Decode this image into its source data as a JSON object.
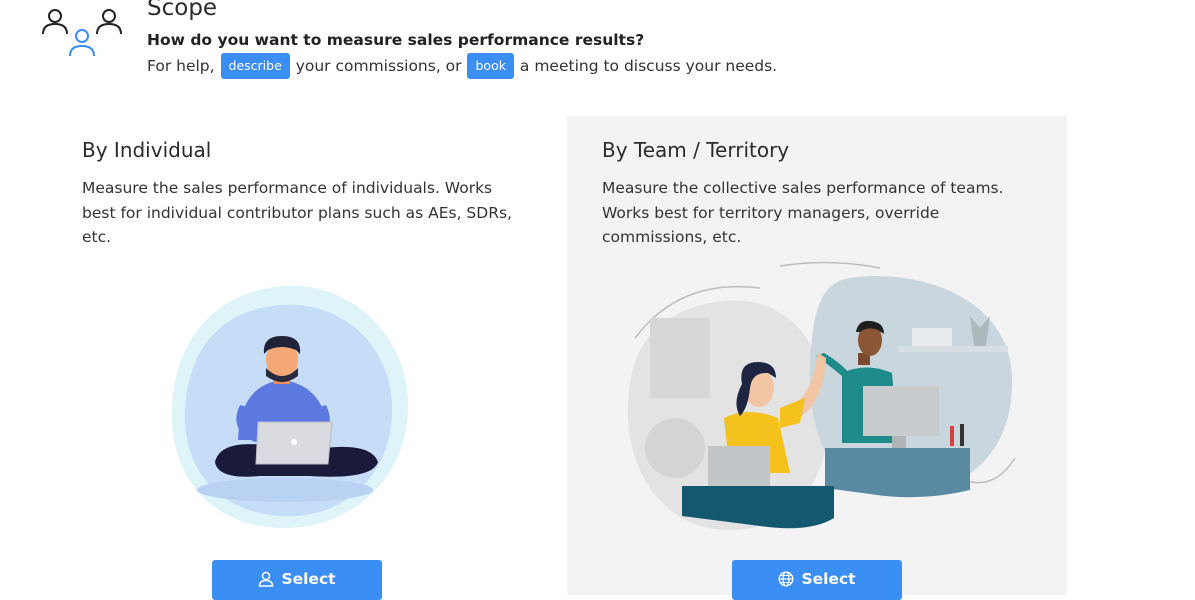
{
  "header": {
    "title": "Scope",
    "question": "How do you want to measure sales performance results?",
    "help_prefix": "For help,",
    "describe_label": "describe",
    "help_middle": "your commissions, or",
    "book_label": "book",
    "help_suffix": "a meeting to discuss your needs."
  },
  "options": [
    {
      "title": "By Individual",
      "description": "Measure the sales performance of individuals. Works best for individual contributor plans such as AEs, SDRs, etc.",
      "button_label": "Select",
      "button_icon": "user-icon",
      "selected": false
    },
    {
      "title": "By Team / Territory",
      "description": "Measure the collective sales performance of teams. Works best for territory managers, override commissions, etc.",
      "button_label": "Select",
      "button_icon": "globe-icon",
      "selected": true
    }
  ],
  "colors": {
    "accent": "#3b8ef3",
    "selected_card_bg": "#f3f3f3"
  }
}
